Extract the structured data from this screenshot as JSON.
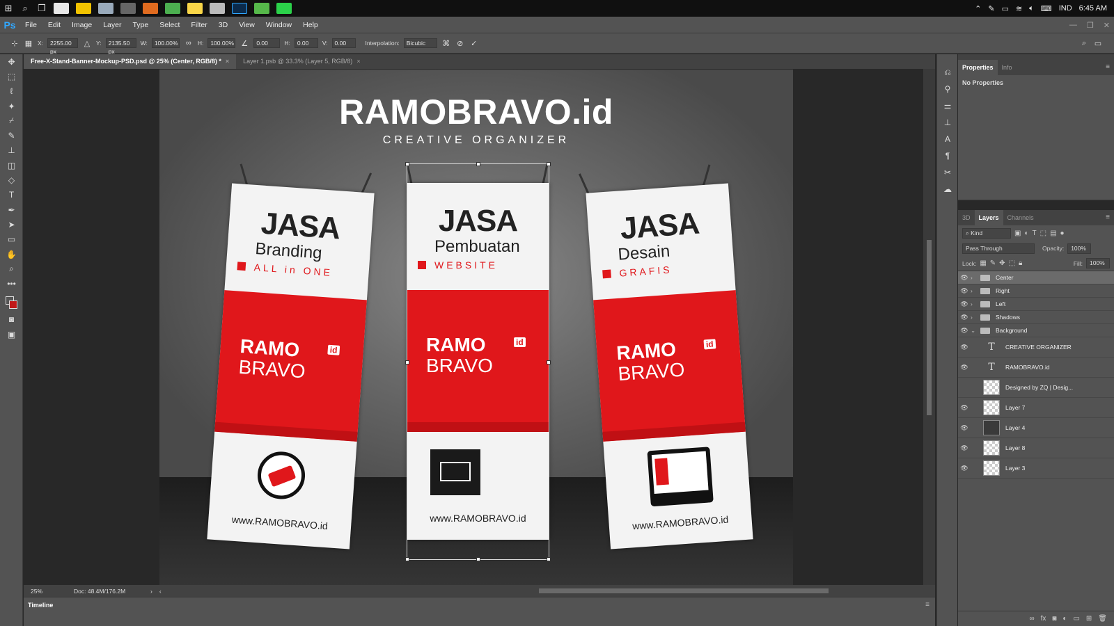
{
  "taskbar": {
    "lang": "IND",
    "time": "6:45 AM"
  },
  "app": {
    "logo": "Ps"
  },
  "menu": [
    "File",
    "Edit",
    "Image",
    "Layer",
    "Type",
    "Select",
    "Filter",
    "3D",
    "View",
    "Window",
    "Help"
  ],
  "options": {
    "x_label": "X:",
    "x_value": "2255.00 px",
    "y_label": "Y:",
    "y_value": "2135.50 px",
    "w_label": "W:",
    "w_value": "100.00%",
    "h_label": "H:",
    "h_value": "100.00%",
    "angle_value": "0.00",
    "hskew_label": "H:",
    "hskew_value": "0.00",
    "vskew_label": "V:",
    "vskew_value": "0.00",
    "interp_label": "Interpolation:",
    "interp_value": "Bicubic"
  },
  "tabs": [
    {
      "label": "Free-X-Stand-Banner-Mockup-PSD.psd @ 25% (Center, RGB/8) *"
    },
    {
      "label": "Layer 1.psb @ 33.3% (Layer 5, RGB/8)"
    }
  ],
  "artwork": {
    "title": "RAMOBRAVO.id",
    "subtitle": "CREATIVE ORGANIZER",
    "banners": [
      {
        "jasa": "JASA",
        "sub": "Branding",
        "red": "ALL in ONE",
        "logo1": "RAMO",
        "logo2": "BRAVO",
        "id": "id",
        "url": "www.RAMOBRAVO.id"
      },
      {
        "jasa": "JASA",
        "sub": "Pembuatan",
        "red": "WEBSITE",
        "logo1": "RAMO",
        "logo2": "BRAVO",
        "id": "id",
        "url": "www.RAMOBRAVO.id"
      },
      {
        "jasa": "JASA",
        "sub": "Desain",
        "red": "GRAFIS",
        "logo1": "RAMO",
        "logo2": "BRAVO",
        "id": "id",
        "url": "www.RAMOBRAVO.id"
      }
    ]
  },
  "status": {
    "zoom": "25%",
    "doc": "Doc: 48.4M/176.2M"
  },
  "timeline": {
    "label": "Timeline"
  },
  "properties": {
    "tab1": "Properties",
    "tab2": "Info",
    "text": "No Properties"
  },
  "layers_panel": {
    "tabs": [
      "3D",
      "Layers",
      "Channels"
    ],
    "kind": "Kind",
    "blend": "Pass Through",
    "opacity_label": "Opacity:",
    "opacity": "100%",
    "lock_label": "Lock:",
    "fill_label": "Fill:",
    "fill": "100%",
    "layers": [
      {
        "name": "Center",
        "type": "group",
        "visible": true,
        "selected": true
      },
      {
        "name": "Right",
        "type": "group",
        "visible": true
      },
      {
        "name": "Left",
        "type": "group",
        "visible": true
      },
      {
        "name": "Shadows",
        "type": "group",
        "visible": true
      },
      {
        "name": "Background",
        "type": "group-open",
        "visible": true
      },
      {
        "name": "CREATIVE ORGANIZER",
        "type": "text",
        "visible": true
      },
      {
        "name": "RAMOBRAVO.id",
        "type": "text",
        "visible": true
      },
      {
        "name": "Designed by ZQ | Desig...",
        "type": "pixel",
        "visible": false
      },
      {
        "name": "Layer 7",
        "type": "pixel",
        "visible": true
      },
      {
        "name": "Layer 4",
        "type": "dark",
        "visible": true
      },
      {
        "name": "Layer 8",
        "type": "pixel",
        "visible": true
      },
      {
        "name": "Layer 3",
        "type": "pixel",
        "visible": true
      }
    ]
  }
}
